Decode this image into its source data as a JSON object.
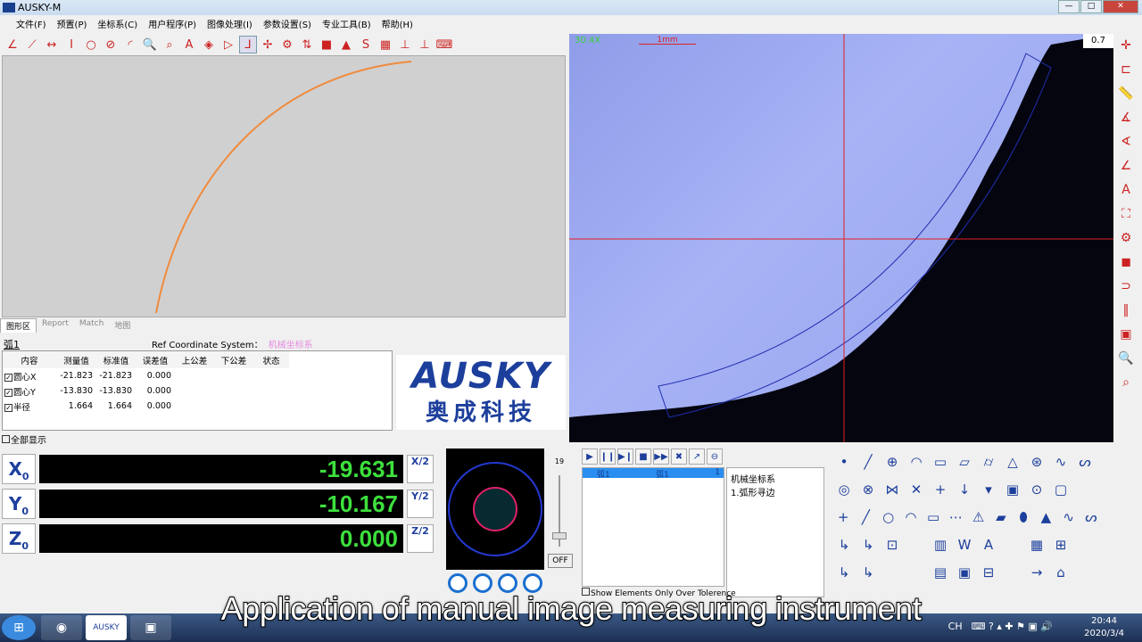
{
  "window": {
    "title": "AUSKY-M"
  },
  "menu": [
    "文件(F)",
    "预置(P)",
    "坐标系(C)",
    "用户程序(P)",
    "图像处理(I)",
    "参数设置(S)",
    "专业工具(B)",
    "帮助(H)"
  ],
  "toolbar": [
    "angle-icon",
    "line-icon",
    "distance-icon",
    "height-icon",
    "circle-icon",
    "no-circle-icon",
    "arc-icon",
    "zoom-in-icon",
    "zoom-fit-icon",
    "text-icon",
    "3d-icon",
    "probe-icon",
    "axis-icon",
    "origin-icon",
    "gear-icon",
    "swap-icon",
    "fill-icon",
    "triangle-icon",
    "s-icon",
    "calc-icon",
    "center-icon",
    "perp-icon",
    "keyboard-icon"
  ],
  "tabs": [
    "图形区",
    "Report",
    "Match",
    "地图"
  ],
  "feature": {
    "name": "弧1",
    "ref_label": "Ref Coordinate System：",
    "ref_value": "机械坐标系"
  },
  "table": {
    "headers": [
      "内容",
      "测量值",
      "标准值",
      "误差值",
      "上公差",
      "下公差",
      "状态"
    ],
    "rows": [
      [
        "圆心X",
        "-21.823",
        "-21.823",
        "0.000"
      ],
      [
        "圆心Y",
        "-13.830",
        "-13.830",
        "0.000"
      ],
      [
        "半径",
        "1.664",
        "1.664",
        "0.000"
      ]
    ]
  },
  "show_all": "全部显示",
  "brand": {
    "name": "AUSKY",
    "cn": "奥成科技"
  },
  "camera": {
    "magnification": "30.4X",
    "scale": "1mm",
    "zoom": "0.7"
  },
  "right_tools": [
    "crosshair-icon",
    "edge-icon",
    "ruler-icon",
    "angle-x-icon",
    "angle-y-icon",
    "angle-icon",
    "text-icon",
    "fullscreen-icon",
    "settings-icon",
    "record-icon",
    "pipe-icon",
    "barcode-icon",
    "capture-icon",
    "zoom-icon",
    "zoom-area-icon"
  ],
  "dro": [
    {
      "axis": "X",
      "value": "-19.631",
      "half": "X/2"
    },
    {
      "axis": "Y",
      "value": "-10.167",
      "half": "Y/2"
    },
    {
      "axis": "Z",
      "value": "0.000",
      "half": "Z/2"
    }
  ],
  "slider": {
    "value": "19",
    "off": "OFF"
  },
  "program": {
    "controls": [
      "▶",
      "❙❙",
      "▶❙",
      "■",
      "▶▶",
      "✖",
      "↗",
      "⊖"
    ],
    "row": {
      "name": "弧1",
      "ref": "弧1",
      "count": "1"
    },
    "detail": [
      "机械坐标系",
      "1.弧形寻边"
    ],
    "show_over": "Show Elements Only Over Tolerence"
  },
  "elements": [
    [
      "•",
      "╱",
      "⊕",
      "◠",
      "▭",
      "▱",
      "⌭",
      "△",
      "⊛",
      "∿",
      "ᔕ"
    ],
    [
      "◎",
      "⊗",
      "⋈",
      "✕",
      "+",
      "↓",
      "▾",
      "▣",
      "⊙",
      "▢"
    ],
    [
      "+",
      "╱",
      "○",
      "◠",
      "▭",
      "⋯",
      "⚠",
      "▰",
      "⬮",
      "▲",
      "∿",
      "ᔕ"
    ],
    [
      "↳",
      "↳",
      "⊡",
      "",
      "▥",
      "W",
      "A",
      "",
      "▦",
      "⊞"
    ],
    [
      "↳",
      "↳",
      "",
      "",
      "▤",
      "▣",
      "⊟",
      "",
      "→",
      "⌂"
    ]
  ],
  "caption": "Application of manual image measuring instrument",
  "tray": {
    "lang": "CH",
    "time": "20:44",
    "date": "2020/3/4"
  }
}
